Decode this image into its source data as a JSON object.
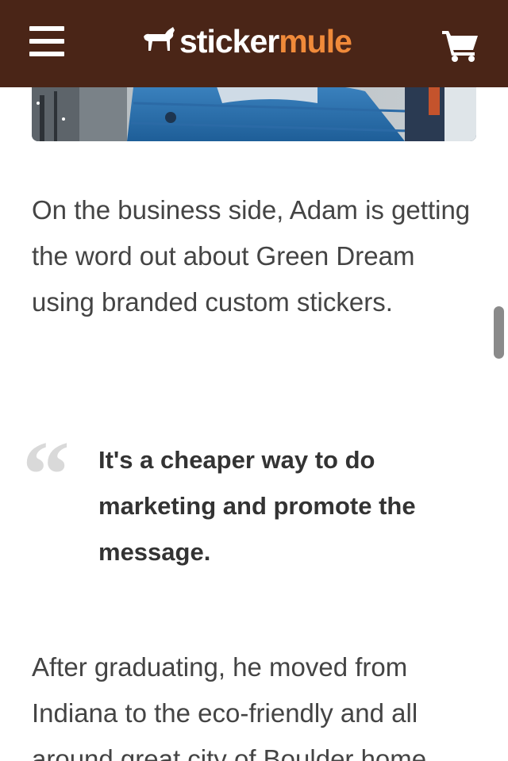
{
  "header": {
    "logo_sticker": "sticker",
    "logo_mule": "mule",
    "brand_color": "#4a2517",
    "accent_color": "#f08a3a",
    "menu_icon": "hamburger-menu-icon",
    "cart_icon": "shopping-cart-icon"
  },
  "article": {
    "paragraph_1": "On the business side, Adam is getting the word out about Green Dream using branded custom stickers.",
    "quote": "It's a cheaper way to do marketing and promote the message.",
    "quote_mark": "“",
    "paragraph_2": "After graduating, he moved from Indiana to the eco-friendly and all around great city of Boulder home"
  }
}
